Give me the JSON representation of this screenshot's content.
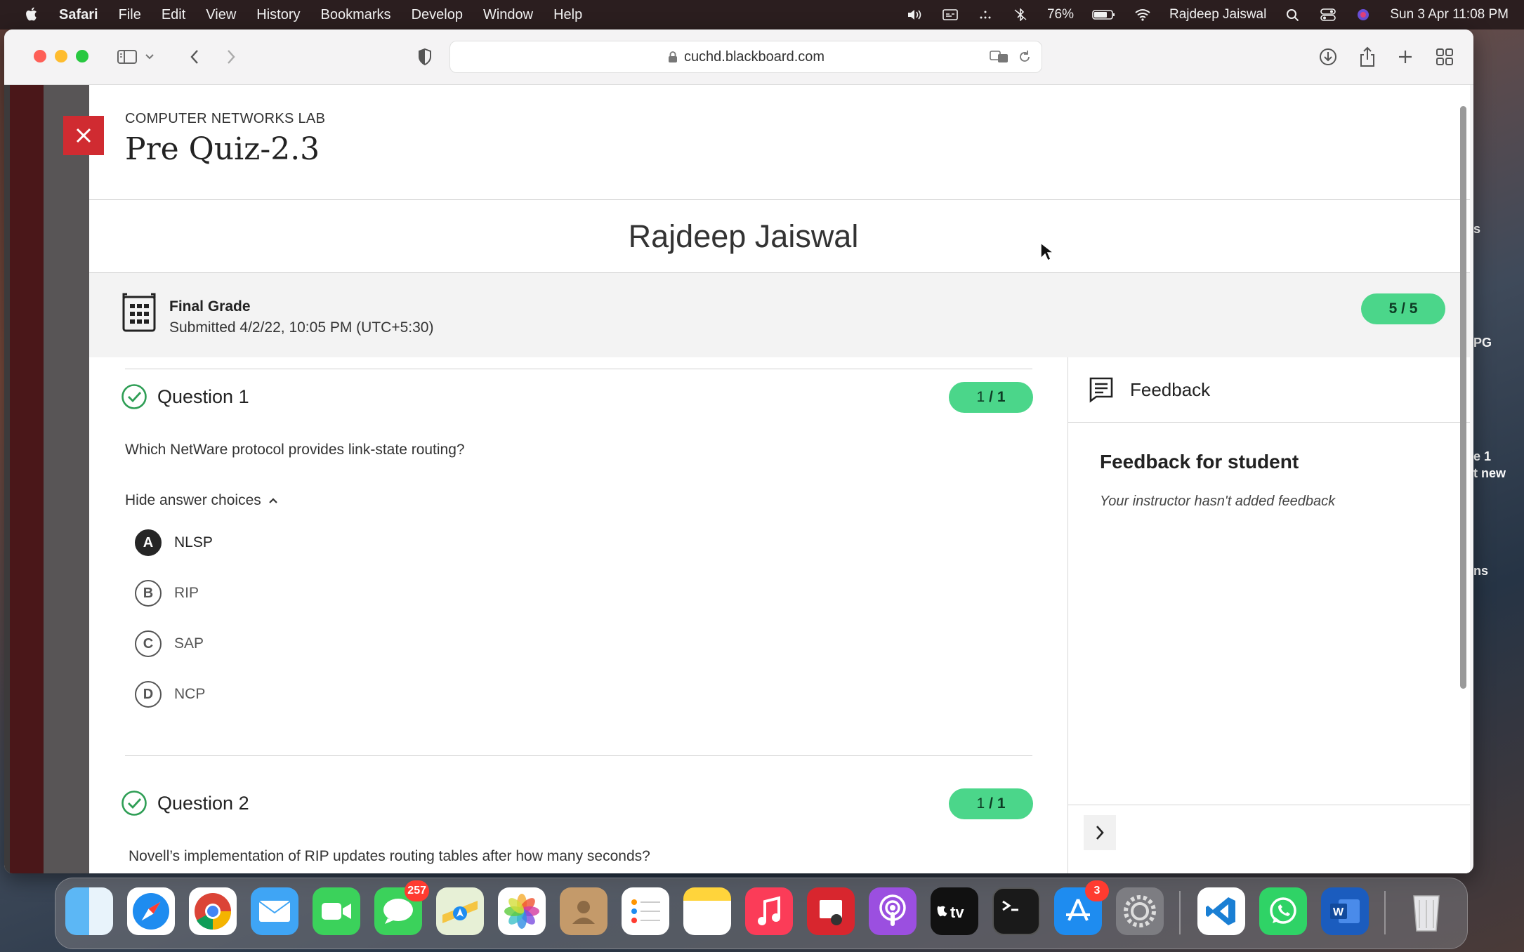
{
  "menubar": {
    "app": "Safari",
    "items": [
      "File",
      "Edit",
      "View",
      "History",
      "Bookmarks",
      "Develop",
      "Window",
      "Help"
    ],
    "battery": "76%",
    "user": "Rajdeep Jaiswal",
    "datetime": "Sun 3 Apr  11:08 PM"
  },
  "desktop_peek": [
    "s",
    "PG",
    "e 1",
    "t new",
    "ns"
  ],
  "browser": {
    "url": "cuchd.blackboard.com"
  },
  "quiz": {
    "course": "COMPUTER NETWORKS LAB",
    "title": "Pre Quiz-2.3",
    "student": "Rajdeep Jaiswal",
    "final_grade_label": "Final Grade",
    "submitted": "Submitted 4/2/22, 10:05 PM (UTC+5:30)",
    "final_score": "5 / 5",
    "hide_choices": "Hide answer choices",
    "questions": [
      {
        "title": "Question 1",
        "score_got": "1",
        "score_total": "/ 1",
        "text": "Which NetWare protocol provides link-state routing?",
        "choices": [
          {
            "letter": "A",
            "label": "NLSP",
            "selected": true
          },
          {
            "letter": "B",
            "label": "RIP",
            "selected": false
          },
          {
            "letter": "C",
            "label": "SAP",
            "selected": false
          },
          {
            "letter": "D",
            "label": "NCP",
            "selected": false
          }
        ]
      },
      {
        "title": "Question 2",
        "score_got": "1",
        "score_total": "/ 1",
        "text": "Novell’s implementation of RIP updates routing tables after how many seconds?"
      }
    ]
  },
  "feedback": {
    "header": "Feedback",
    "title": "Feedback for student",
    "note": "Your instructor hasn't added feedback"
  },
  "dock": {
    "messages_badge": "257",
    "appstore_badge": "3",
    "apps": [
      "finder",
      "safari",
      "chrome",
      "mail",
      "facetime",
      "messages",
      "maps",
      "photos",
      "contacts",
      "reminders",
      "notes",
      "music",
      "photo-booth",
      "podcasts",
      "apple-tv",
      "terminal",
      "app-store",
      "system-preferences",
      "vscode",
      "whatsapp",
      "word",
      "trash"
    ]
  },
  "colors": {
    "accent_green": "#4bd68a",
    "close_red": "#d02b31",
    "check_green": "#2e9e55"
  }
}
